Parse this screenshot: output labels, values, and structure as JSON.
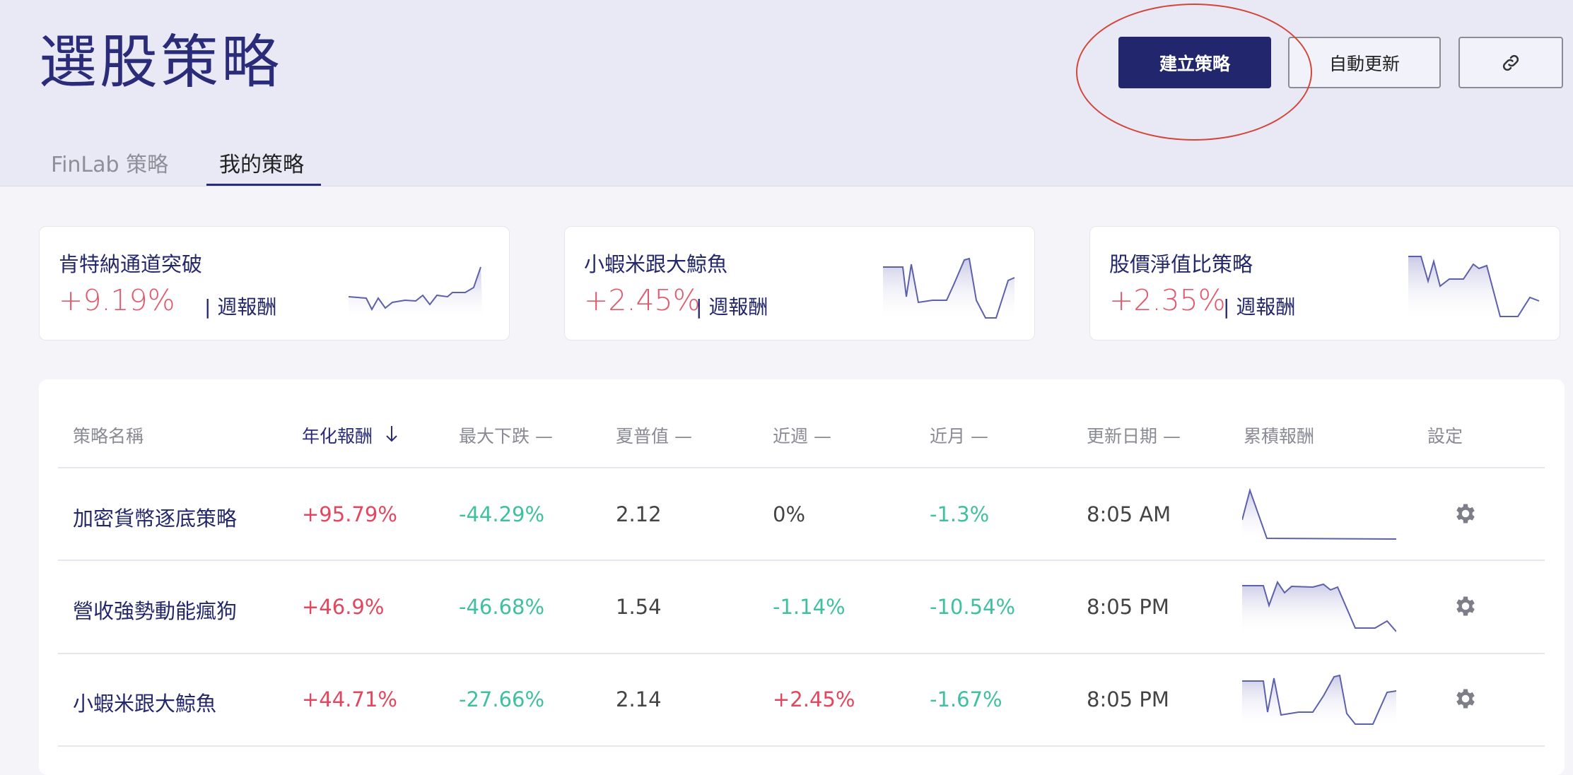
{
  "header": {
    "title": "選股策略",
    "buttons": {
      "create": "建立策略",
      "auto_update": "自動更新",
      "link_icon": "link-icon"
    }
  },
  "tabs": [
    {
      "label": "FinLab 策略",
      "active": false
    },
    {
      "label": "我的策略",
      "active": true
    }
  ],
  "summary_cards": [
    {
      "name": "肯特納通道突破",
      "value": "+9.19%",
      "unit": "| 週報酬"
    },
    {
      "name": "小蝦米跟大鯨魚",
      "value": "+2.45%",
      "unit": "| 週報酬"
    },
    {
      "name": "股價淨值比策略",
      "value": "+2.35%",
      "unit": "| 週報酬"
    }
  ],
  "table": {
    "headers": {
      "name": "策略名稱",
      "annual_return": "年化報酬",
      "max_drawdown": "最大下跌 —",
      "sharpe": "夏普值 —",
      "week": "近週 —",
      "month": "近月 —",
      "updated": "更新日期 —",
      "cumulative": "累積報酬",
      "settings": "設定"
    },
    "sort_icon": "arrow-down-icon",
    "rows": [
      {
        "name": "加密貨幣逐底策略",
        "annual_return": "+95.79%",
        "max_drawdown": "-44.29%",
        "sharpe": "2.12",
        "week": "0%",
        "month": "-1.3%",
        "updated": "8:05 AM"
      },
      {
        "name": "營收強勢動能瘋狗",
        "annual_return": "+46.9%",
        "max_drawdown": "-46.68%",
        "sharpe": "1.54",
        "week": "-1.14%",
        "month": "-10.54%",
        "updated": "8:05 PM"
      },
      {
        "name": "小蝦米跟大鯨魚",
        "annual_return": "+44.71%",
        "max_drawdown": "-27.66%",
        "sharpe": "2.14",
        "week": "+2.45%",
        "month": "-1.67%",
        "updated": "8:05 PM"
      }
    ],
    "settings_icon": "gear-icon"
  },
  "colors": {
    "brand": "#22266d",
    "positive": "#e2475f",
    "negative": "#3fc0a0",
    "header_bg": "#e9e9f6",
    "highlight": "#d2473a"
  }
}
